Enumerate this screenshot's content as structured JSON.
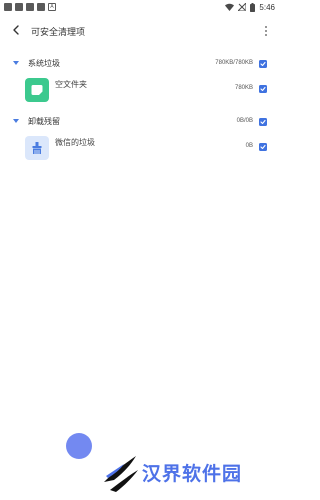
{
  "status_bar": {
    "time": "5:46",
    "notification_icons": [
      "square-icon",
      "square-icon",
      "square-icon",
      "square-icon",
      "a-icon"
    ],
    "notification_letter": "A",
    "right_icons": [
      "wifi-icon",
      "signal-icon",
      "battery-icon"
    ]
  },
  "header": {
    "title": "可安全清理项",
    "back_icon": "chevron-left-icon",
    "menu_icon": "more-vertical-icon"
  },
  "groups": [
    {
      "title": "系统垃圾",
      "size": "780KB/780KB",
      "checked": true,
      "items": [
        {
          "label": "空文件夹",
          "size": "780KB",
          "checked": true,
          "icon": "folder-icon",
          "icon_color": "#3cc98e"
        }
      ]
    },
    {
      "title": "卸载残留",
      "size": "0B/0B",
      "checked": true,
      "items": [
        {
          "label": "微信的垃圾",
          "size": "0B",
          "checked": true,
          "icon": "broom-icon",
          "icon_color": "#dbe7fb"
        }
      ]
    }
  ],
  "watermark": {
    "text": "汉界软件园"
  },
  "colors": {
    "accent": "#3f72e0",
    "caret": "#4a7ce0",
    "folder_icon_bg": "#3cc98e",
    "broom_icon_bg": "#dbe7fb",
    "watermark": "#4e72e8"
  }
}
